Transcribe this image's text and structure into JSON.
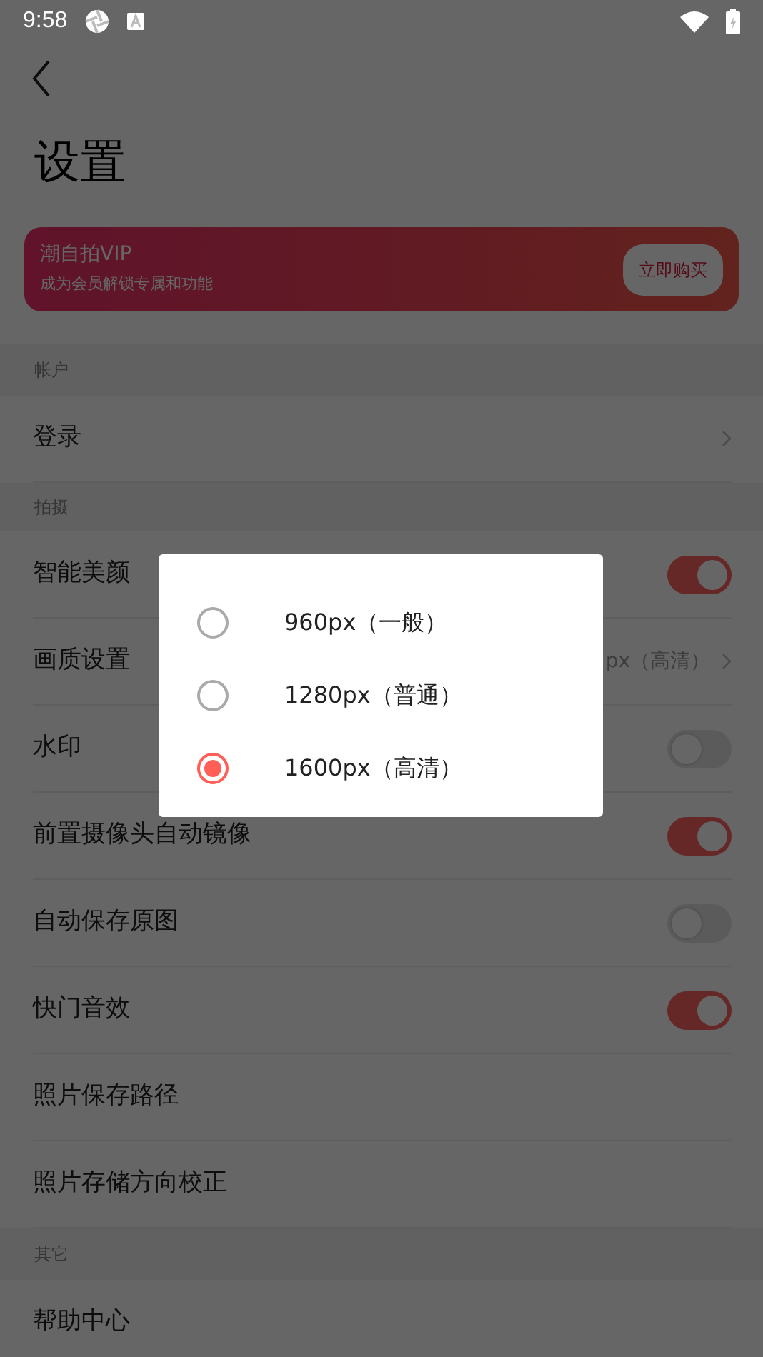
{
  "status_bar": {
    "time": "9:58"
  },
  "title": "设置",
  "vip_banner": {
    "title": "潮自拍VIP",
    "subtitle": "成为会员解锁专属和功能",
    "button": "立即购买"
  },
  "sections": [
    {
      "header": "帐户",
      "rows": [
        {
          "label": "登录",
          "kind": "link"
        }
      ]
    },
    {
      "header": "拍摄",
      "rows": [
        {
          "label": "智能美颜",
          "kind": "toggle",
          "on": true
        },
        {
          "label": "画质设置",
          "kind": "link",
          "value": "px（高清）"
        },
        {
          "label": "水印",
          "kind": "toggle",
          "on": false
        },
        {
          "label": "前置摄像头自动镜像",
          "kind": "toggle",
          "on": true
        },
        {
          "label": "自动保存原图",
          "kind": "toggle",
          "on": false
        },
        {
          "label": "快门音效",
          "kind": "toggle",
          "on": true
        },
        {
          "label": "照片保存路径",
          "kind": "plain"
        },
        {
          "label": "照片存储方向校正",
          "kind": "plain"
        }
      ]
    },
    {
      "header": "其它",
      "rows": [
        {
          "label": "帮助中心",
          "kind": "plain"
        }
      ]
    }
  ],
  "dialog": {
    "options": [
      {
        "label": "960px（一般）",
        "selected": false
      },
      {
        "label": "1280px（普通）",
        "selected": false
      },
      {
        "label": "1600px（高清）",
        "selected": true
      }
    ]
  }
}
